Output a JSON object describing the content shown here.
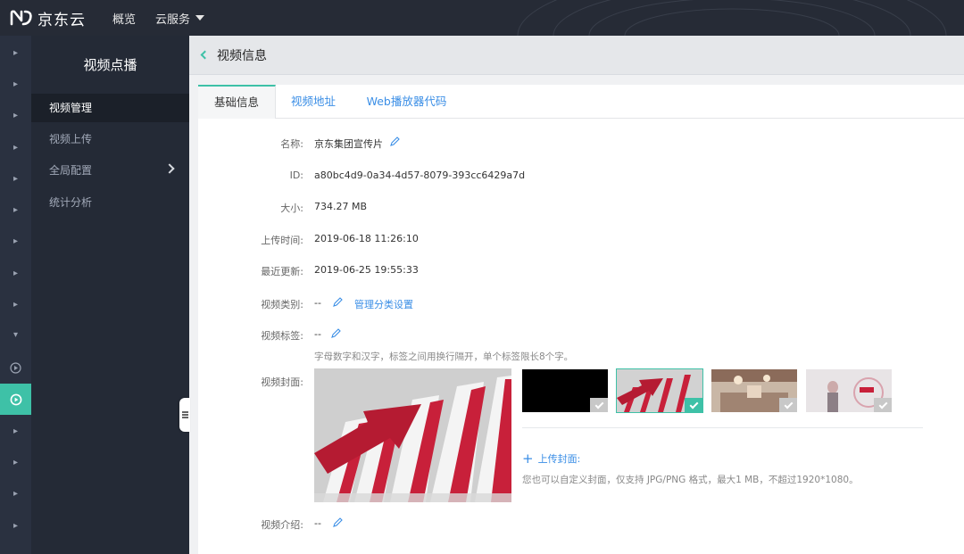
{
  "brand": {
    "name": "京东云"
  },
  "topnav": {
    "overview": "概览",
    "cloud_services": "云服务"
  },
  "sidebar": {
    "title": "视频点播",
    "items": [
      {
        "label": "视频管理",
        "active": true
      },
      {
        "label": "视频上传",
        "active": false
      },
      {
        "label": "全局配置",
        "active": false,
        "has_submenu": true
      },
      {
        "label": "统计分析",
        "active": false
      }
    ]
  },
  "page": {
    "title": "视频信息"
  },
  "tabs": [
    {
      "label": "基础信息",
      "active": true
    },
    {
      "label": "视频地址",
      "active": false
    },
    {
      "label": "Web播放器代码",
      "active": false
    }
  ],
  "info": {
    "name_label": "名称:",
    "name_value": "京东集团宣传片",
    "id_label": "ID:",
    "id_value": "a80bc4d9-0a34-4d57-8079-393cc6429a7d",
    "size_label": "大小:",
    "size_value": "734.27 MB",
    "upload_time_label": "上传时间:",
    "upload_time_value": "2019-06-18 11:26:10",
    "updated_label": "最近更新:",
    "updated_value": "2019-06-25 19:55:33",
    "category_label": "视频类别:",
    "category_value": "--",
    "category_link": "管理分类设置",
    "tags_label": "视频标签:",
    "tags_value": "--",
    "tags_hint": "字母数字和汉字，标签之间用换行隔开，单个标签限长8个字。",
    "cover_label": "视频封面:",
    "cover_upload": "上传封面:",
    "cover_hint": "您也可以自定义封面，仅支持 JPG/PNG 格式，最大1 MB，不超过1920*1080。",
    "intro_label": "视频介绍:",
    "intro_value": "--"
  },
  "cover_thumbs": [
    {
      "name": "black-frame",
      "selected": false
    },
    {
      "name": "red-arrow-stairs",
      "selected": true
    },
    {
      "name": "conference-hall",
      "selected": false
    },
    {
      "name": "presenter-stage",
      "selected": false
    }
  ],
  "colors": {
    "accent": "#3ec1a7",
    "link": "#3a8ee6",
    "topbar": "#262b36",
    "sidebar": "#242a36"
  }
}
